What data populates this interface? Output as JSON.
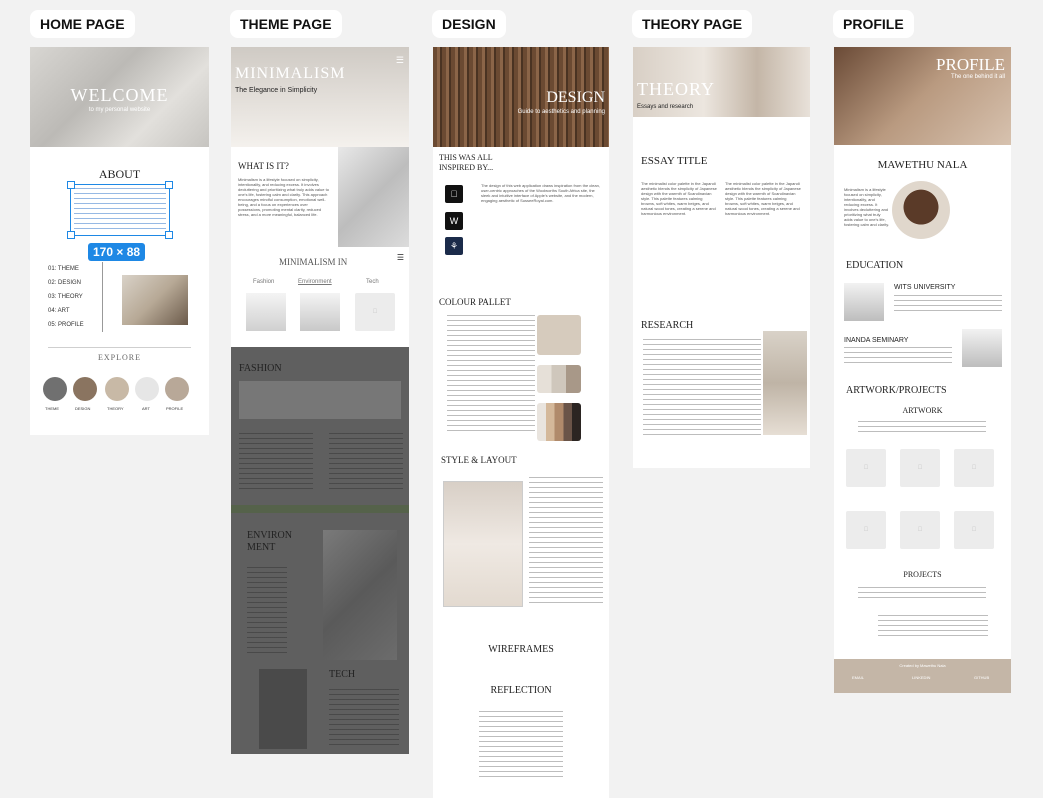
{
  "frames": {
    "home": "HOME PAGE",
    "theme": "THEME PAGE",
    "design": "DESIGN",
    "theory": "THEORY PAGE",
    "profile": "PROFILE"
  },
  "home": {
    "hero_title": "WELCOME",
    "hero_subtitle": "to my personal website",
    "about_title": "ABOUT",
    "selection_size": "170 × 88",
    "menu": [
      "01: THEME",
      "02: DESIGN",
      "03: THEORY",
      "04: ART",
      "05: PROFILE"
    ],
    "explore_title": "EXPLORE",
    "explore_items": [
      "THEME",
      "DESIGN",
      "THEORY",
      "ART",
      "PROFILE"
    ]
  },
  "theme": {
    "hero_title": "MINIMALISM",
    "hero_subtitle": "The Elegance in Simplicity",
    "what_title": "WHAT IS IT?",
    "what_text": "Minimalism is a lifestyle focused on simplicity, intentionality, and reducing excess. It involves decluttering and prioritizing what truly adds value to one's life, fostering calm and clarity. This approach encourages mindful consumption, emotional well-being, and a focus on experiences over possessions, promoting mental clarity, reduced stress, and a more meaningful, balanced life.",
    "in_title": "MINIMALISM IN",
    "tabs": [
      "Fashion",
      "Environment",
      "Tech"
    ],
    "fashion_title": "FASHION",
    "environment_title": "ENVIRON MENT",
    "tech_title": "TECH"
  },
  "design": {
    "hero_title": "DESIGN",
    "hero_subtitle": "Guide to aesthetics and planning",
    "inspired_title": "THIS WAS ALL INSPIRED BY...",
    "inspired_text": "The design of this web application draws inspiration from the clean, user-centric approaches of the Woolworths South Africa site, the sleek and intuitive interface of Apple's website, and the modern, engaging aesthetic of SusseeRoyal.com.",
    "colour_title": "COLOUR PALLET",
    "style_title": "STYLE & LAYOUT",
    "wireframes_title": "WIREFRAMES",
    "reflection_title": "REFLECTION"
  },
  "theory": {
    "hero_title": "THEORY",
    "hero_subtitle": "Essays and research",
    "essay_title": "ESSAY TITLE",
    "research_title": "RESEARCH",
    "body_text": "The minimalist color palette in the Japandi aesthetic blends the simplicity of Japanese design with the warmth of Scandinavian style. This palette features calming browns, soft whites, warm beiges, and natural wood tones, creating a serene and harmonious environment."
  },
  "profile": {
    "hero_title": "PROFILE",
    "hero_subtitle": "The one behind it all",
    "name": "MAWETHU NALA",
    "intro_text": "Minimalism is a lifestyle focused on simplicity, intentionality, and reducing excess. It involves decluttering and prioritizing what truly adds value to one's life, fostering calm and clarity.",
    "education_title": "EDUCATION",
    "edu_1": "WITS UNIVERSITY",
    "edu_2": "INANDA SEMINARY",
    "artwork_title": "ARTWORK/PROJECTS",
    "artwork_sub": "ARTWORK",
    "projects_sub": "PROJECTS",
    "footer_credit": "Created by Mawethu Nala",
    "footer_cols": [
      "EMAIL",
      "LINKEDIN",
      "GITHUB"
    ]
  }
}
